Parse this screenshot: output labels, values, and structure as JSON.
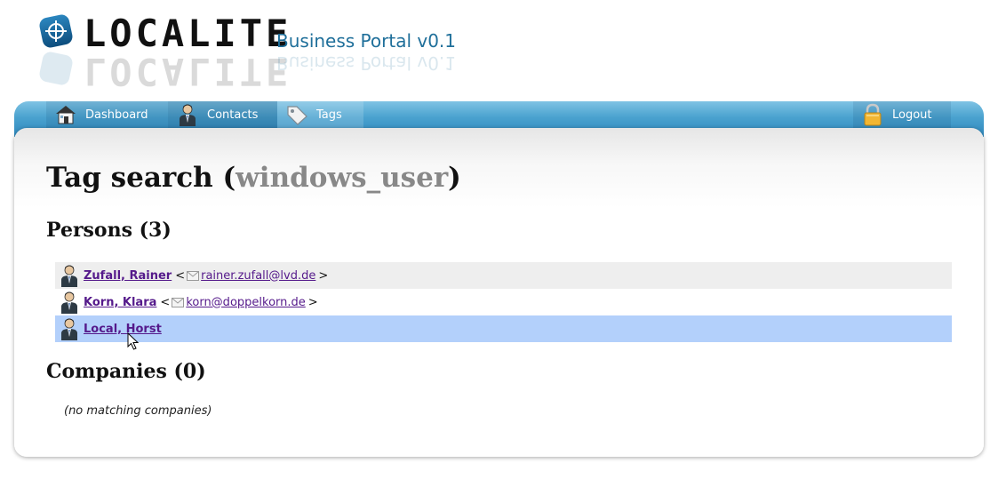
{
  "header": {
    "logo_text": "LOCALITE",
    "subtitle": "Business Portal v0.1"
  },
  "nav": {
    "items": [
      {
        "label": "Dashboard",
        "icon": "house-icon"
      },
      {
        "label": "Contacts",
        "icon": "person-icon"
      },
      {
        "label": "Tags",
        "icon": "tag-icon"
      }
    ],
    "logout": {
      "label": "Logout",
      "icon": "lock-icon"
    }
  },
  "main": {
    "title_prefix": "Tag search (",
    "tag": "windows_user",
    "title_suffix": ")",
    "persons_heading": "Persons (3)",
    "persons": [
      {
        "name": "Zufall, Rainer",
        "open": "<",
        "email": "rainer.zufall@lvd.de",
        "close": ">"
      },
      {
        "name": "Korn, Klara",
        "open": "<",
        "email": "korn@doppelkorn.de",
        "close": ">"
      },
      {
        "name": "Local, Horst"
      }
    ],
    "companies_heading": "Companies (0)",
    "no_companies": "(no matching companies)"
  },
  "colors": {
    "nav_bar": "#4aa2cf",
    "subtitle": "#1f6f9a",
    "link": "#551a8b",
    "row_hover": "#b3d0fb",
    "row_alt": "#eeeeee",
    "tag_gray": "#888888"
  }
}
